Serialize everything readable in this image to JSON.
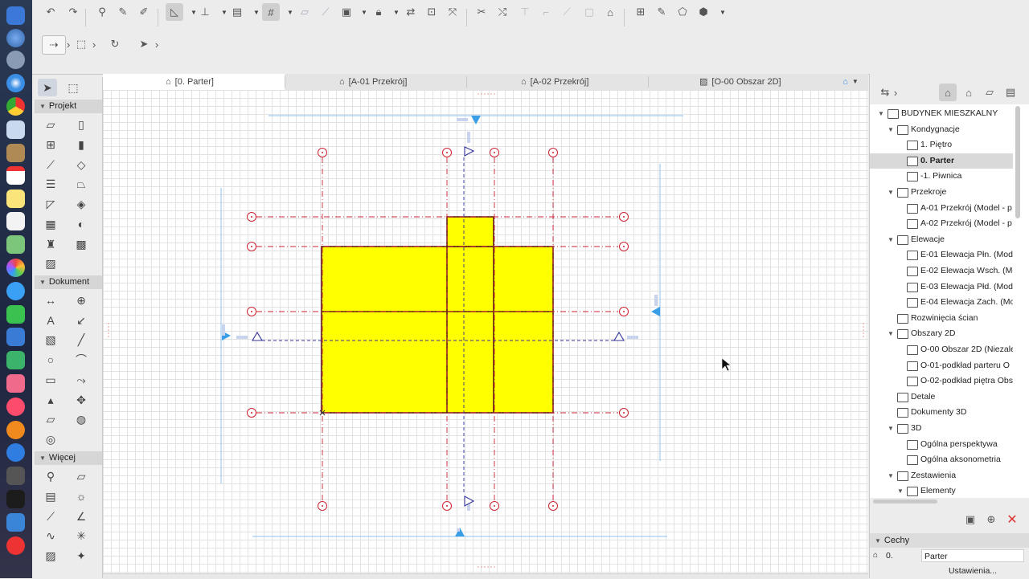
{
  "tabs": [
    {
      "label": "[0. Parter]",
      "icon": "floorplan-icon"
    },
    {
      "label": "[A-01 Przekrój]",
      "icon": "section-icon"
    },
    {
      "label": "[A-02 Przekrój]",
      "icon": "section-icon"
    },
    {
      "label": "[O-00 Obszar 2D]",
      "icon": "worksheet-icon"
    }
  ],
  "toolbox": {
    "sections": [
      {
        "label": "Projekt"
      },
      {
        "label": "Dokument"
      },
      {
        "label": "Więcej"
      }
    ]
  },
  "navigator": {
    "items": [
      {
        "label": "BUDYNEK MIESZKALNY",
        "level": 0,
        "tri": "▼"
      },
      {
        "label": "Kondygnacje",
        "level": 1,
        "tri": "▼"
      },
      {
        "label": "1. Piętro",
        "level": 2,
        "tri": ""
      },
      {
        "label": "0. Parter",
        "level": 2,
        "tri": "",
        "selected": true
      },
      {
        "label": "-1. Piwnica",
        "level": 2,
        "tri": ""
      },
      {
        "label": "Przekroje",
        "level": 1,
        "tri": "▼"
      },
      {
        "label": "A-01 Przekrój (Model - p",
        "level": 2,
        "tri": ""
      },
      {
        "label": "A-02 Przekrój (Model - p",
        "level": 2,
        "tri": ""
      },
      {
        "label": "Elewacje",
        "level": 1,
        "tri": "▼"
      },
      {
        "label": "E-01 Elewacja Płn. (Mod",
        "level": 2,
        "tri": ""
      },
      {
        "label": "E-02 Elewacja Wsch. (Mo",
        "level": 2,
        "tri": ""
      },
      {
        "label": "E-03 Elewacja Płd. (Mod",
        "level": 2,
        "tri": ""
      },
      {
        "label": "E-04 Elewacja Zach. (Mo",
        "level": 2,
        "tri": ""
      },
      {
        "label": "Rozwinięcia ścian",
        "level": 1,
        "tri": ""
      },
      {
        "label": "Obszary 2D",
        "level": 1,
        "tri": "▼"
      },
      {
        "label": "O-00 Obszar 2D (Niezale",
        "level": 2,
        "tri": ""
      },
      {
        "label": "O-01-podkład parteru O",
        "level": 2,
        "tri": ""
      },
      {
        "label": "O-02-podkład piętra Obs",
        "level": 2,
        "tri": ""
      },
      {
        "label": "Detale",
        "level": 1,
        "tri": ""
      },
      {
        "label": "Dokumenty 3D",
        "level": 1,
        "tri": ""
      },
      {
        "label": "3D",
        "level": 1,
        "tri": "▼"
      },
      {
        "label": "Ogólna perspektywa",
        "level": 2,
        "tri": ""
      },
      {
        "label": "Ogólna aksonometria",
        "level": 2,
        "tri": ""
      },
      {
        "label": "Zestawienia",
        "level": 1,
        "tri": "▼"
      },
      {
        "label": "Elementy",
        "level": 2,
        "tri": "▼"
      }
    ],
    "properties": {
      "header": "Cechy",
      "id_label": "0.",
      "name_value": "Parter",
      "settings_button": "Ustawienia..."
    }
  },
  "colors": {
    "building_fill": "#ffff00",
    "grid_line": "#cc2233",
    "marker_blue": "#3a9ee6",
    "section_line": "#333399"
  }
}
